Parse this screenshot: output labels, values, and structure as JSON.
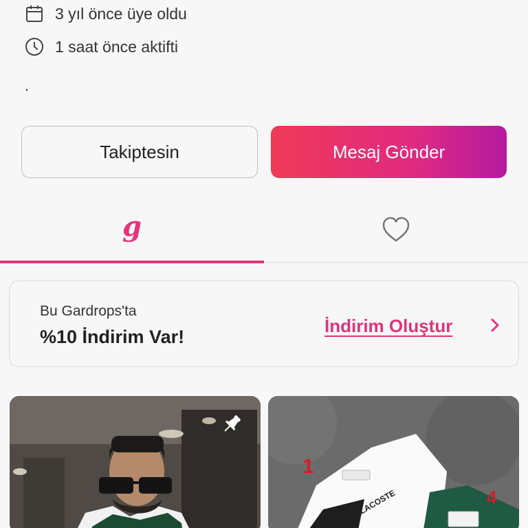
{
  "profile": {
    "member_since": "3 yıl önce üye oldu",
    "last_active": "1 saat önce aktifti",
    "bio": "."
  },
  "actions": {
    "follow_label": "Takiptesin",
    "message_label": "Mesaj Gönder"
  },
  "tabs": [
    {
      "name": "closet",
      "icon": "gardrops-logo-icon",
      "active": true
    },
    {
      "name": "likes",
      "icon": "heart-icon",
      "active": false
    }
  ],
  "promo": {
    "line1": "Bu Gardrops'ta",
    "line2": "%10 İndirim Var!",
    "link_label": "İndirim Oluştur"
  },
  "products": [
    {
      "image": "man-in-sunglasses-photo",
      "pinned": true
    },
    {
      "image": "lacoste-tshirts-photo",
      "overlay_numbers": [
        "1",
        "4"
      ]
    }
  ],
  "colors": {
    "accent": "#e8337a",
    "gradient_start": "#f03a58",
    "gradient_end": "#b51aa0"
  }
}
